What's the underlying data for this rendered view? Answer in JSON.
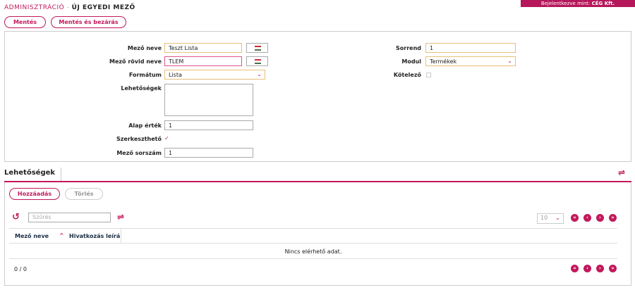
{
  "breadcrumb": {
    "parent": "ADMINISZTRÁCIÓ",
    "separator": " - ",
    "current": "ÚJ EGYEDI MEZŐ"
  },
  "login": {
    "prefix": "Bejelentkezve mint: ",
    "company": "CÉG Kft."
  },
  "toolbar": {
    "save": "Mentés",
    "save_close": "Mentés és bezárás"
  },
  "form": {
    "field_name_label": "Mező neve",
    "field_name_value": "Teszt Lista",
    "short_name_label": "Mező rövid neve",
    "short_name_value": "TLEM",
    "format_label": "Formátum",
    "format_value": "Lista",
    "options_label": "Lehetőségek",
    "default_label": "Alap érték",
    "default_value": "1",
    "editable_label": "Szerkeszthető",
    "order_no_label": "Mező sorszám",
    "order_no_value": "1",
    "sort_label": "Sorrend",
    "sort_value": "1",
    "module_label": "Modul",
    "module_value": "Termékek",
    "required_label": "Kötelező"
  },
  "tab": {
    "title": "Lehetőségek"
  },
  "grid": {
    "add": "Hozzáadás",
    "delete": "Törlés",
    "search_placeholder": "Szűrés",
    "page_size": "10",
    "columns": [
      "Mező neve",
      "Hivatkozás leírá"
    ],
    "empty": "Nincs elérhető adat.",
    "pager": "0 / 0"
  },
  "colors": {
    "accent": "#c2185b"
  }
}
